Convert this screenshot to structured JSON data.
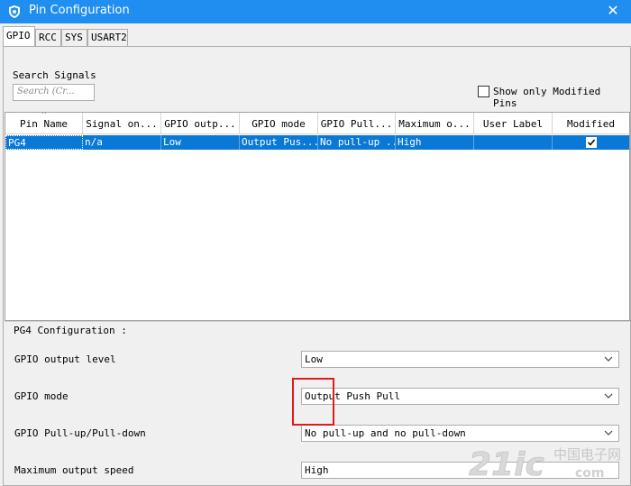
{
  "window": {
    "title": "Pin Configuration",
    "close_glyph": "✕",
    "icon": "shield-icon"
  },
  "tabs": [
    {
      "label": "GPIO",
      "active": true
    },
    {
      "label": "RCC"
    },
    {
      "label": "SYS"
    },
    {
      "label": "USART2"
    }
  ],
  "search": {
    "label": "Search Signals",
    "placeholder": "Search (Cr..."
  },
  "filters": {
    "show_modified_label": "Show only Modified Pins",
    "show_modified_checked": false
  },
  "table": {
    "columns": [
      "Pin Name",
      "Signal on...",
      "GPIO outp...",
      "GPIO mode",
      "GPIO Pull...",
      "Maximum o...",
      "User Label",
      "Modified"
    ],
    "rows": [
      {
        "pin": "PG4",
        "signal": "n/a",
        "output": "Low",
        "mode": "Output Pus...",
        "pull": "No pull-up ...",
        "speed": "High",
        "label": "",
        "modified": true
      }
    ]
  },
  "config": {
    "title": "PG4 Configuration :",
    "fields": [
      {
        "label": "GPIO output level",
        "value": "Low"
      },
      {
        "label": "GPIO mode",
        "value": "Output Push Pull"
      },
      {
        "label": "GPIO Pull-up/Pull-down",
        "value": "No pull-up and no pull-down"
      },
      {
        "label": "Maximum output speed",
        "value": "High"
      }
    ]
  },
  "colors": {
    "accent": "#1f8ef0",
    "selection": "#0a78d7",
    "highlight_box": "#e11b1b"
  },
  "watermark": {
    "logo_text": "21ic",
    "cn_text": "中国电子网",
    "domain": "com"
  }
}
